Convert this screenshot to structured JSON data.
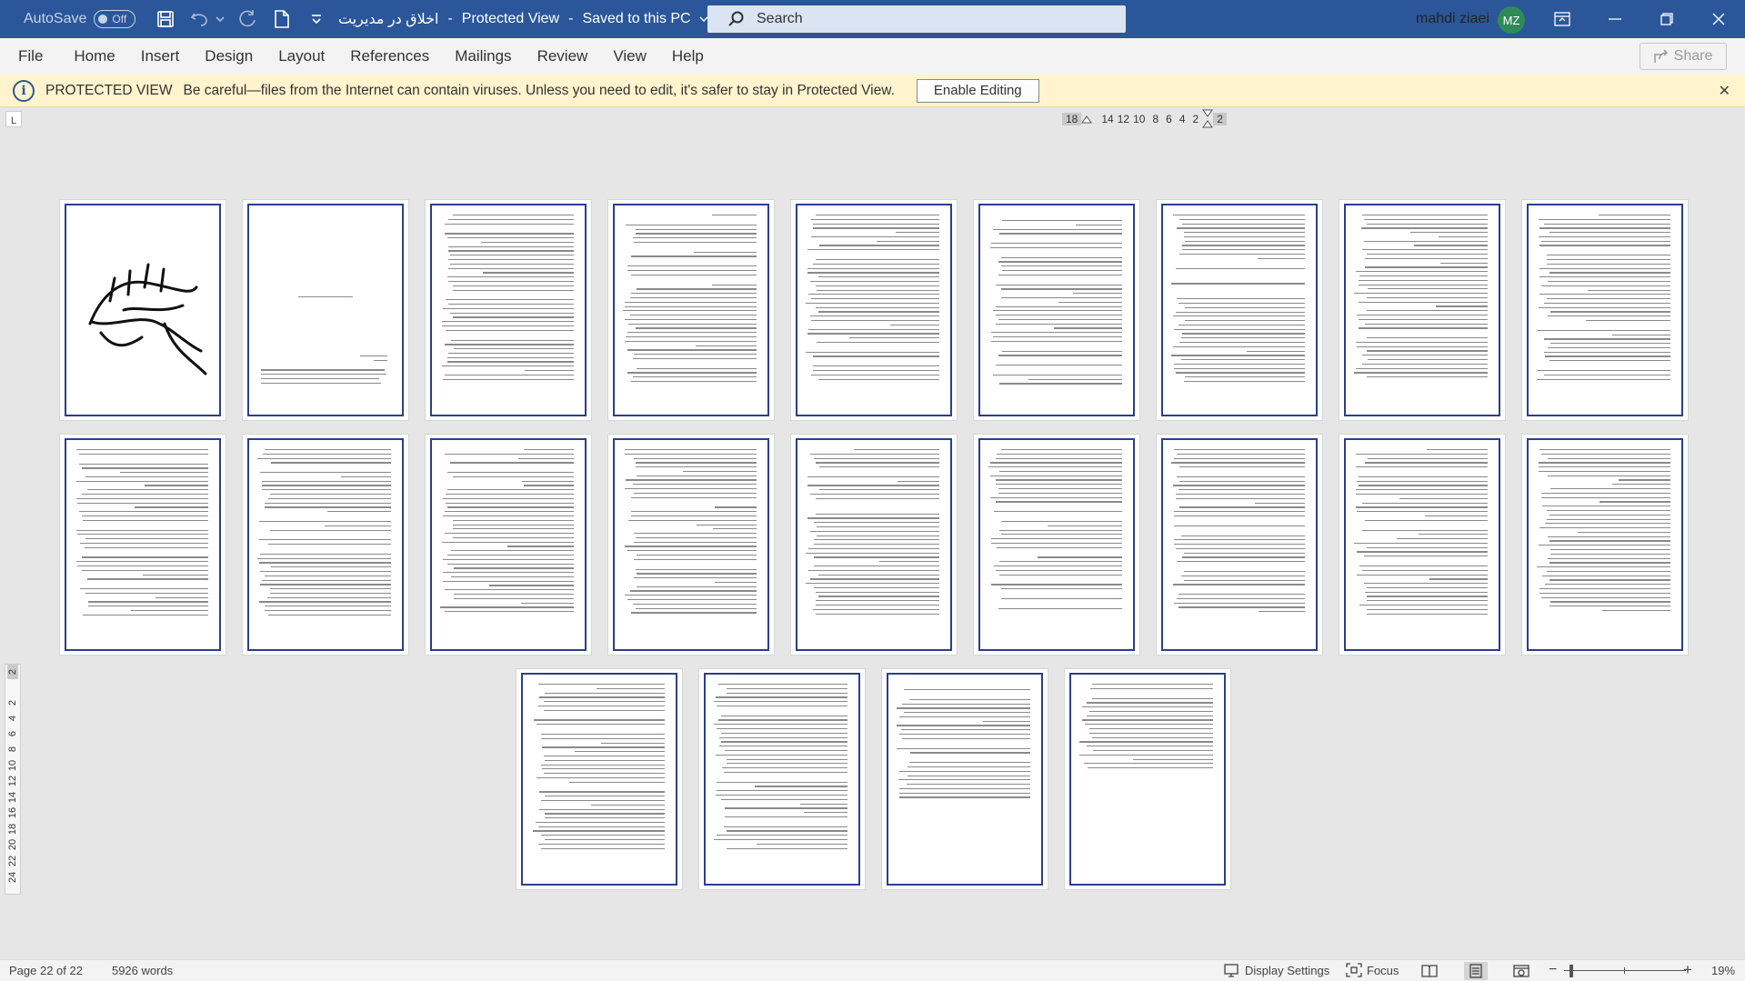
{
  "titlebar": {
    "autosave_label": "AutoSave",
    "autosave_state": "Off",
    "doc_name": "اخلاق در مدیریت",
    "separator": "-",
    "view_mode": "Protected View",
    "separator2": "-",
    "save_status": "Saved to this PC",
    "search_placeholder": "Search",
    "user_name": "mahdi ziaei",
    "user_initials": "MZ",
    "accent": "#2b579a"
  },
  "ribbon": {
    "tabs": [
      "File",
      "Home",
      "Insert",
      "Design",
      "Layout",
      "References",
      "Mailings",
      "Review",
      "View",
      "Help"
    ],
    "share_label": "Share"
  },
  "protected_bar": {
    "title": "PROTECTED VIEW",
    "message": "Be careful—files from the Internet can contain viruses. Unless you need to edit, it's safer to stay in Protected View.",
    "enable_label": "Enable Editing",
    "close_glyph": "✕"
  },
  "ruler": {
    "tab_selector": "L",
    "h_values": [
      "18",
      "14",
      "12",
      "10",
      "8",
      "6",
      "4",
      "2",
      "2"
    ],
    "v_values": [
      "2",
      "2",
      "4",
      "6",
      "8",
      "10",
      "12",
      "14",
      "16",
      "18",
      "20",
      "22",
      "24"
    ]
  },
  "status": {
    "page": "Page 22 of 22",
    "words": "5926 words",
    "display_settings": "Display Settings",
    "focus": "Focus",
    "zoom_minus": "−",
    "zoom_plus": "+",
    "zoom": "19%"
  },
  "icons": {
    "save": "save-icon",
    "undo": "undo-icon",
    "redo": "redo-icon",
    "new": "new-document-icon",
    "customize": "customize-qat-icon",
    "search": "search-icon",
    "ribbon_display": "ribbon-display-icon",
    "minimize": "minimize-icon",
    "restore": "restore-icon",
    "close": "close-icon",
    "shield_info": "info-icon",
    "share": "share-icon"
  }
}
